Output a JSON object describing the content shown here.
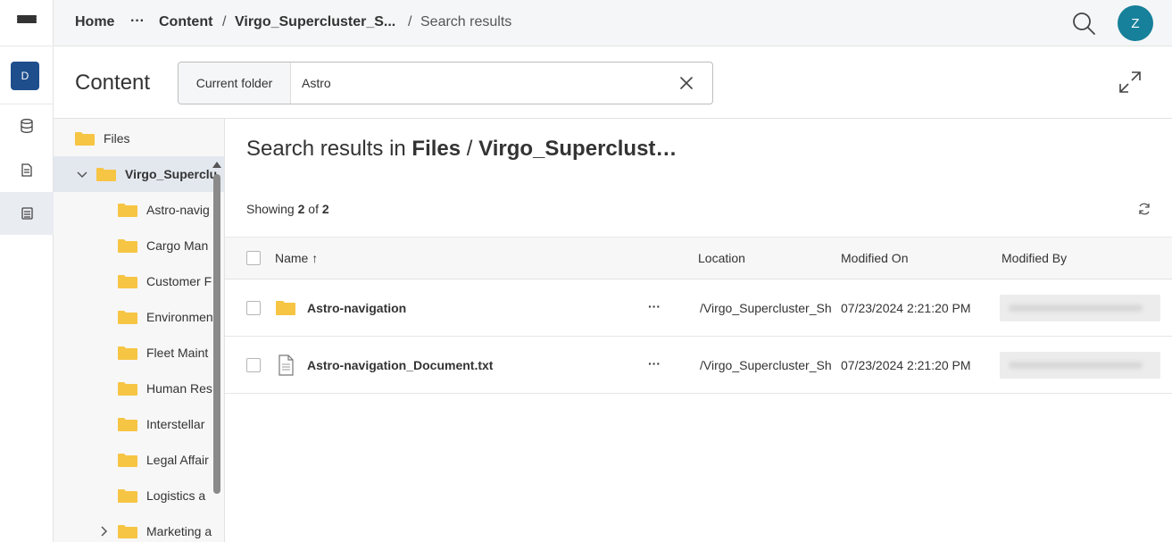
{
  "app": {
    "user_initial": "Z",
    "workspace_initial": "D"
  },
  "breadcrumb": {
    "home": "Home",
    "ellipsis": "···",
    "content": "Content",
    "folder": "Virgo_Supercluster_S...",
    "sep": "/",
    "current": "Search results"
  },
  "header": {
    "title": "Content",
    "search": {
      "scope": "Current folder",
      "value": "Astro"
    }
  },
  "tree": {
    "root": "Files",
    "selected": "Virgo_Superclu",
    "children": [
      "Astro-navig",
      "Cargo Man",
      "Customer F",
      "Environmen",
      "Fleet Maint",
      "Human Res",
      "Interstellar",
      "Legal Affair",
      "Logistics a",
      "Marketing a"
    ]
  },
  "results": {
    "title_prefix": "Search results in",
    "title_files": "Files",
    "title_sep": "/",
    "title_folder": "Virgo_Superclust…",
    "showing_label": "Showing",
    "showing_count": "2",
    "showing_of": "of",
    "showing_total": "2",
    "columns": {
      "name": "Name",
      "sort_icon": "↑",
      "location": "Location",
      "modified_on": "Modified On",
      "modified_by": "Modified By"
    },
    "rows": [
      {
        "type": "folder",
        "name": "Astro-navigation",
        "more": "···",
        "location": "/Virgo_Supercluster_Sh",
        "modified_on": "07/23/2024 2:21:20 PM"
      },
      {
        "type": "file",
        "name": "Astro-navigation_Document.txt",
        "more": "···",
        "location": "/Virgo_Supercluster_Sh",
        "modified_on": "07/23/2024 2:21:20 PM"
      }
    ]
  },
  "colors": {
    "accent": "#17809a",
    "workspace": "#1e4e8c",
    "folder": "#f7c544",
    "selected_row": "#e3e8ef"
  }
}
